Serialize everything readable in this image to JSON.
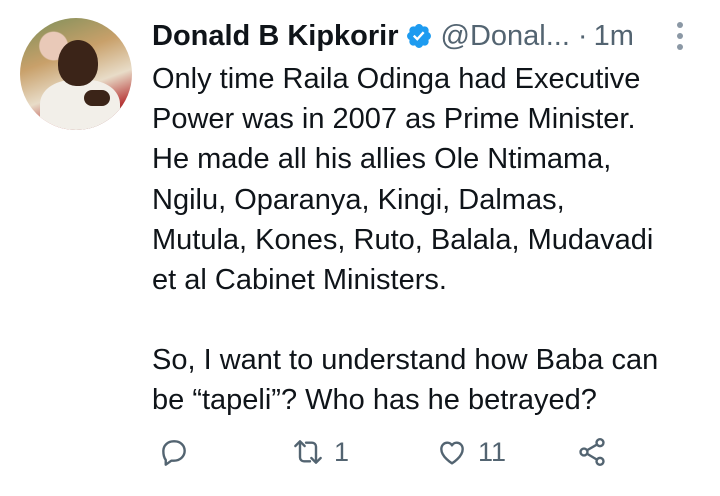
{
  "tweet": {
    "author_name": "Donald B Kipkorir",
    "handle": "@Donal...",
    "separator": "·",
    "time": "1m",
    "paragraphs": [
      [
        "Only time Raila Odinga had Executive",
        "Power was in 2007 as Prime Minister.",
        "He made all his allies Ole Ntimama,",
        "Ngilu, Oparanya, Kingi, Dalmas,",
        "Mutula, Kones, Ruto, Balala, Mudavadi",
        "et al Cabinet Ministers."
      ],
      [
        "So, I want to understand how Baba can",
        "be “tapeli”? Who has he betrayed?"
      ]
    ],
    "retweet_count": "1",
    "like_count": "11",
    "icons": {
      "avatar": "profile-photo",
      "verified": "verified-badge-icon",
      "more": "more-vertical-icon",
      "reply": "reply-icon",
      "retweet": "retweet-icon",
      "like": "heart-icon",
      "share": "share-icon"
    },
    "colors": {
      "verified": "#1d9bf0",
      "secondary": "#536471",
      "text": "#0f1419"
    }
  }
}
